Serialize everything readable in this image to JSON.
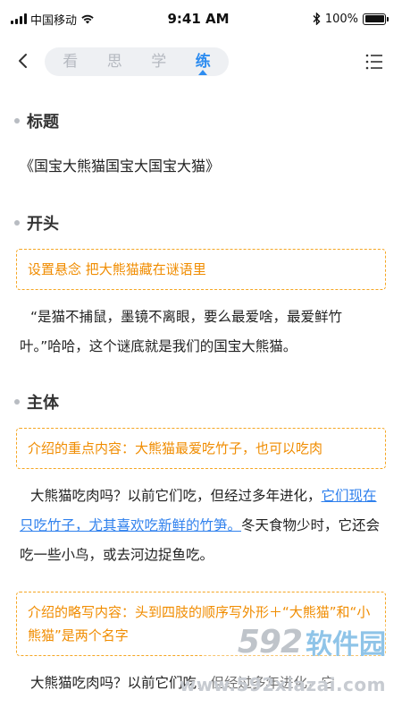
{
  "status_bar": {
    "carrier": "中国移动",
    "time": "9:41 AM",
    "battery": "100%",
    "battery_level": 1.0
  },
  "nav": {
    "tabs": [
      {
        "label": "看",
        "active": false
      },
      {
        "label": "思",
        "active": false
      },
      {
        "label": "学",
        "active": false
      },
      {
        "label": "练",
        "active": true
      }
    ]
  },
  "sections": {
    "title": {
      "heading": "标题",
      "text": "《国宝大熊猫国宝大国宝大猫》"
    },
    "opening": {
      "heading": "开头",
      "hint": "设置悬念  把大熊猫藏在谜语里",
      "para": "“是猫不捕鼠，墨镜不离眼，要么最爱啥，最爱鲜竹叶。”哈哈，这个谜底就是我们的国宝大熊猫。"
    },
    "body": {
      "heading": "主体",
      "hint1": "介绍的重点内容：大熊猫最爱吃竹子，也可以吃肉",
      "para1_before": "大熊猫吃肉吗？以前它们吃，但经过多年进化，",
      "para1_link": "它们现在只吃竹子，尤其喜欢吃新鲜的竹笋。",
      "para1_after": "冬天食物少时，它还会吃一些小鸟，或去河边捉鱼吃。",
      "hint2": "介绍的略写内容：头到四肢的顺序写外形＋“大熊猫”和“小熊猫”是两个名字",
      "para2": "大熊猫吃肉吗？以前它们吃，但经过多年进化，它"
    }
  },
  "watermark": {
    "number": "592",
    "brand": "软件园",
    "url": "www.592xiazai.com"
  },
  "colors": {
    "accent": "#2d8cf0",
    "hint_orange": "#f08c00",
    "hint_border": "#f5a623",
    "link": "#2f80ed"
  }
}
